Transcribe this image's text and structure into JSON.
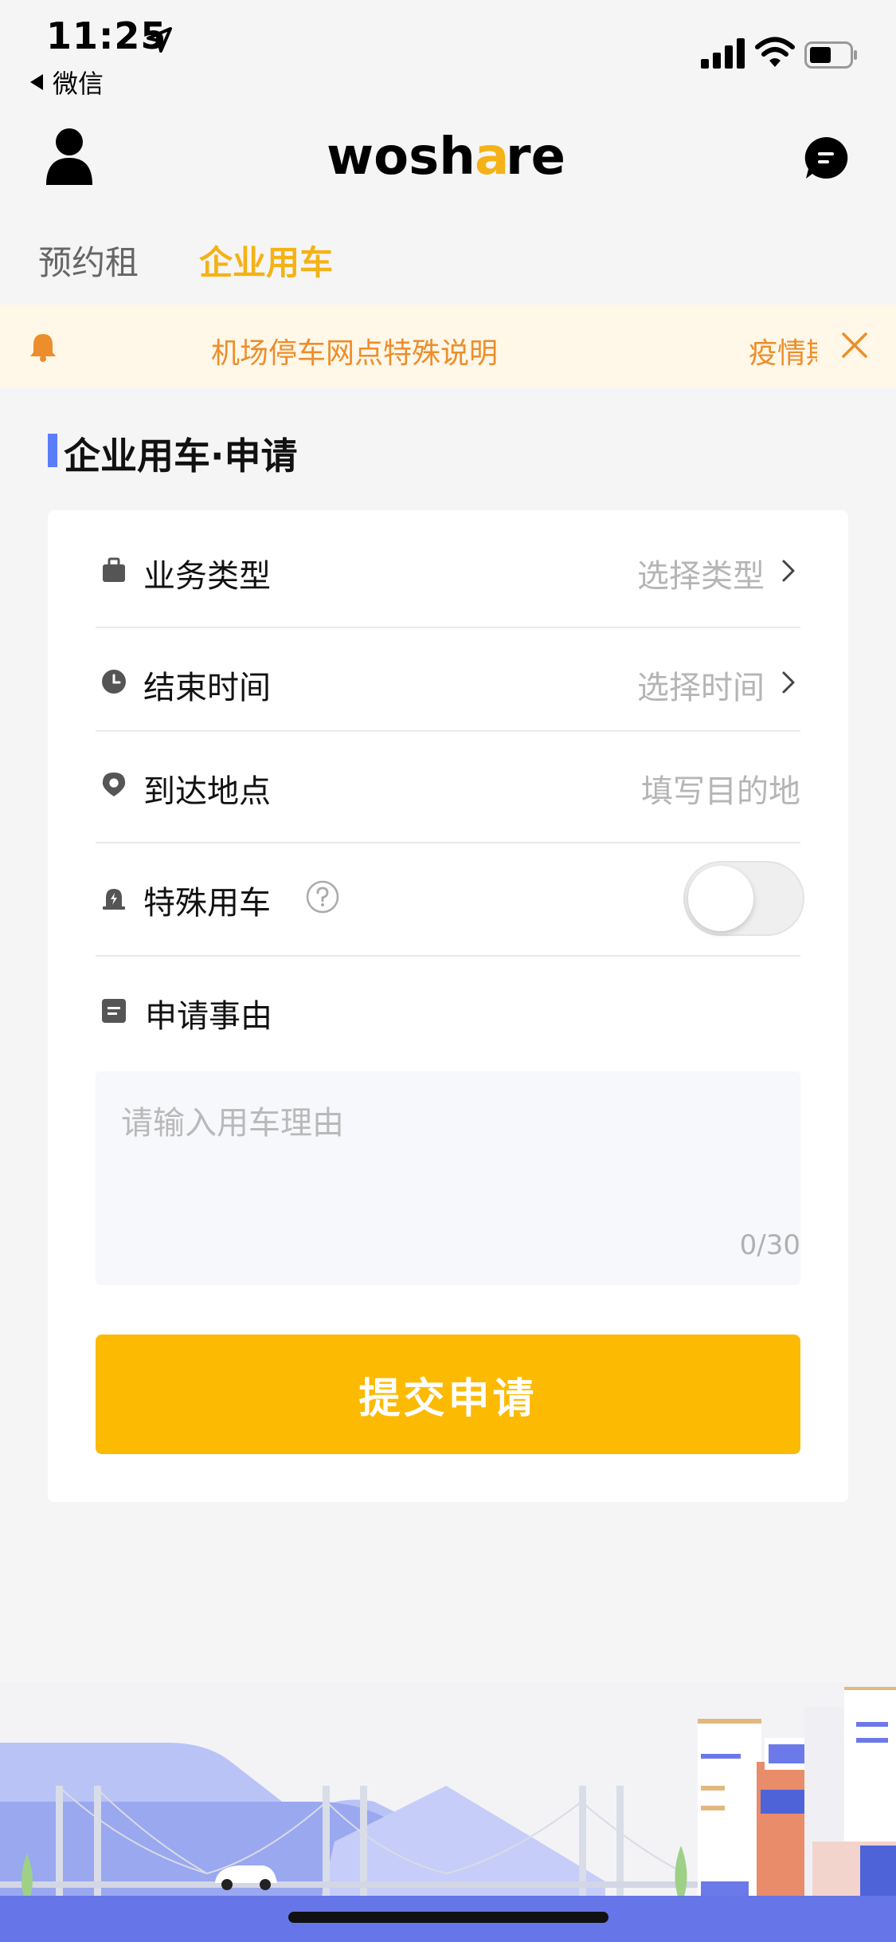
{
  "status_bar": {
    "time": "11:25",
    "back_app": "微信"
  },
  "header": {
    "logo_text_dark_1": "wosh",
    "logo_text_accent": "a",
    "logo_text_dark_2": "re"
  },
  "tabs": [
    {
      "label": "预约租",
      "active": false
    },
    {
      "label": "企业用车",
      "active": true
    }
  ],
  "notice": {
    "text": "机场停车网点特殊说明",
    "text_next": "疫情期"
  },
  "section": {
    "title": "企业用车·申请"
  },
  "form": {
    "business_type": {
      "label": "业务类型",
      "value": "选择类型"
    },
    "end_time": {
      "label": "结束时间",
      "value": "选择时间"
    },
    "destination": {
      "label": "到达地点",
      "placeholder": "填写目的地"
    },
    "special": {
      "label": "特殊用车",
      "enabled": false
    },
    "reason": {
      "label": "申请事由",
      "placeholder": "请输入用车理由",
      "count": "0/30"
    },
    "submit_label": "提交申请"
  },
  "colors": {
    "accent": "#f5b216",
    "button": "#fcba03",
    "notice_text": "#ec8e2b",
    "section_bar": "#5a7dfa"
  },
  "icons": [
    "location-arrow-icon",
    "signal-icon",
    "wifi-icon",
    "battery-icon",
    "user-icon",
    "chat-icon",
    "bell-icon",
    "close-icon",
    "briefcase-icon",
    "clock-icon",
    "map-pin-icon",
    "siren-icon",
    "help-icon",
    "document-icon",
    "chevron-right-icon"
  ]
}
